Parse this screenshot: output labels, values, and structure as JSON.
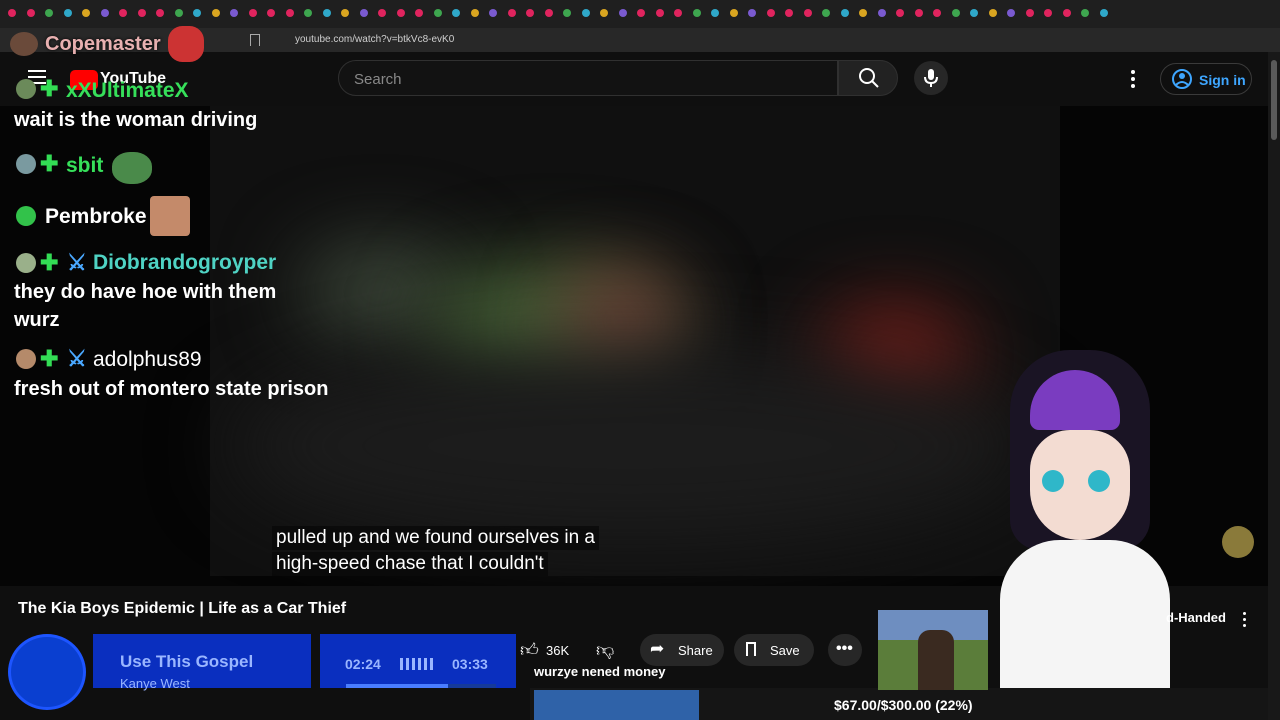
{
  "browser": {
    "url": "youtube.com/watch?v=btkVc8-evK0"
  },
  "stream": {
    "streamer_name": "Copemaster"
  },
  "youtube": {
    "logo_text": "YouTube",
    "search_placeholder": "Search",
    "signin_label": "Sign in"
  },
  "chat": [
    {
      "user": "xXUltimateX",
      "message": "wait is the woman driving",
      "name_color": "#36e05a"
    },
    {
      "user": "sbit",
      "message": "",
      "name_color": "#36e05a"
    },
    {
      "user": "Pembroke",
      "message": "",
      "name_color": "#ffffff"
    },
    {
      "user": "Diobrandogroyper",
      "message": "they do have hoe with them wurz",
      "name_color": "#4fd3c4"
    },
    {
      "user": "adolphus89",
      "message": "fresh out of montero state prison",
      "name_color": "#ffffff"
    }
  ],
  "video": {
    "caption_line1": "pulled up and we found ourselves in a",
    "caption_line2": "high-speed chase that I couldn't",
    "title": "The Kia Boys Epidemic | Life as a Car Thief",
    "like_count": "36K",
    "share_label": "Share",
    "save_label": "Save",
    "sidebar_partial_title": "d-Handed"
  },
  "music": {
    "song": "Use This Gospel",
    "artist": "Kanye West",
    "elapsed": "02:24",
    "total": "03:33",
    "progress": 0.68
  },
  "overlay": {
    "alert_text": "wurzye nened money",
    "donation_text": "$67.00/$300.00 (22%)",
    "donation_progress": 0.22
  },
  "colors": {
    "accent_blue": "#0a2fbf",
    "link_blue": "#3ea6ff",
    "chat_green": "#36e05a"
  }
}
